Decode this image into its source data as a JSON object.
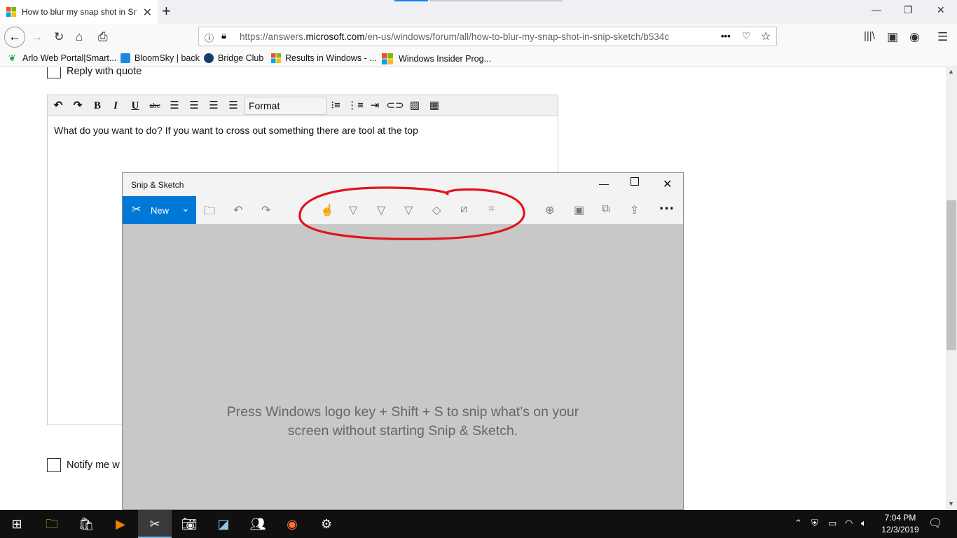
{
  "browser": {
    "tab_title": "How to blur my snap shot in Snip & Sketch",
    "new_tab": "+",
    "url_prefix": "https://answers.",
    "url_domain": "microsoft.com",
    "url_rest": "/en-us/windows/forum/all/how-to-blur-my-snap-shot-in-snip-sketch/b534c",
    "page_actions": "•••"
  },
  "bookmarks": [
    {
      "label": "Arlo Web Portal|Smart..."
    },
    {
      "label": "BloomSky | back"
    },
    {
      "label": "Bridge Club"
    },
    {
      "label": "Results in Windows - ..."
    },
    {
      "label": "Windows Insider Prog..."
    }
  ],
  "page": {
    "reply_with_quote": "Reply with quote",
    "format_label": "Format",
    "editor_text": "What do you want to do?  If you want to cross out something there are tool at the top",
    "notify_label": "Notify me w"
  },
  "snip": {
    "title": "Snip & Sketch",
    "new_label": "New",
    "hint_line1": "Press Windows logo key + Shift + S to snip what’s on your",
    "hint_line2": "screen without starting Snip & Sketch.",
    "more": "···"
  },
  "taskbar": {
    "time": "7:04 PM",
    "date": "12/3/2019"
  },
  "colors": {
    "snip_accent": "#0078d7",
    "annotation_red": "#e0141e",
    "tab_indicator": "#0a84ff"
  }
}
